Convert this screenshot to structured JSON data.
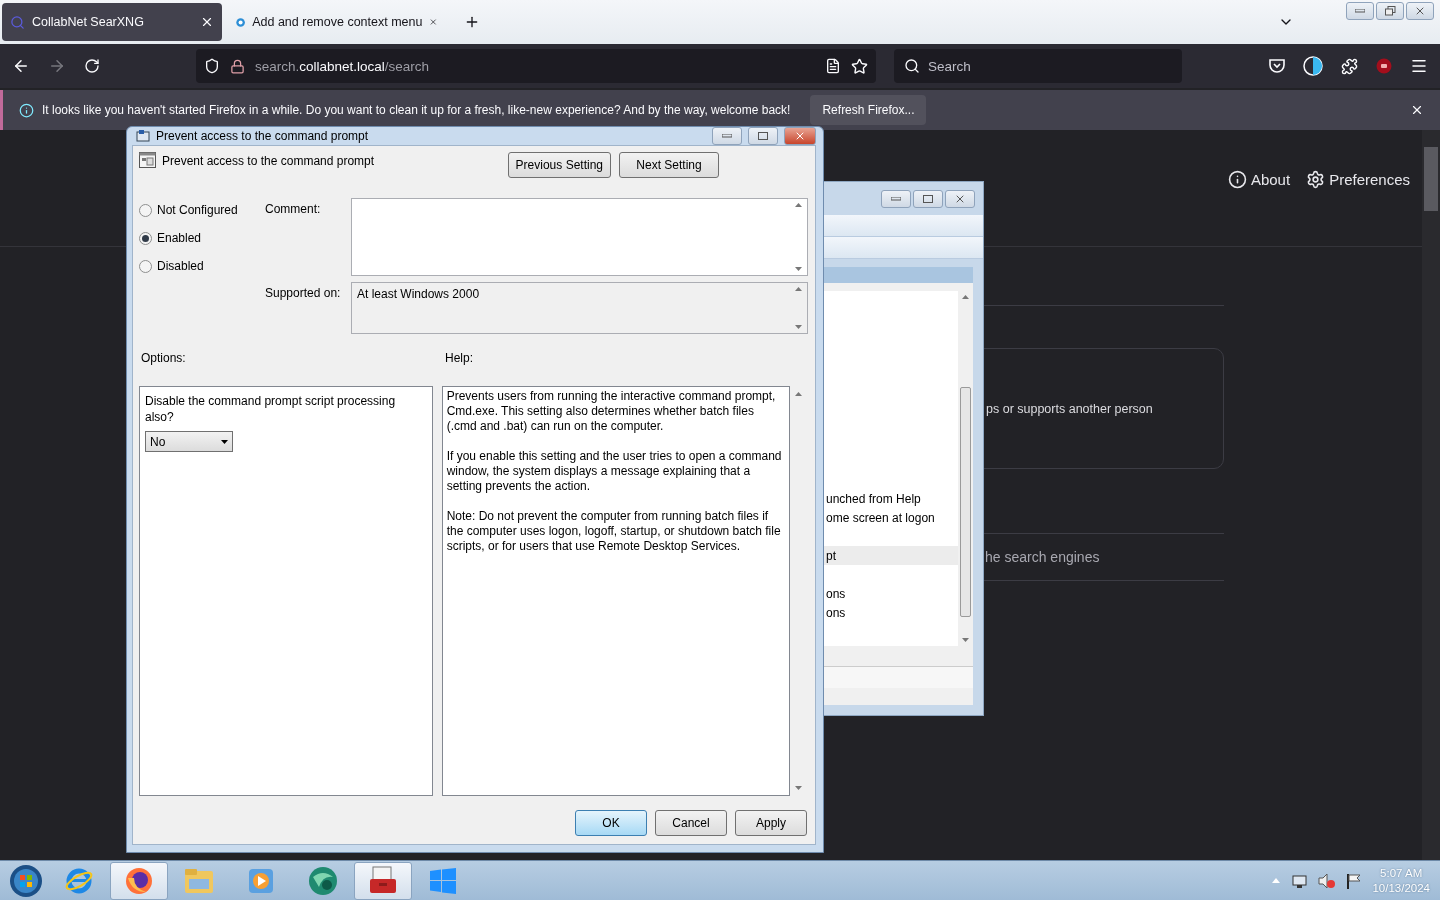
{
  "browser": {
    "tabs": [
      {
        "title": "CollabNet SearXNG",
        "kind": "search",
        "selected": true
      },
      {
        "title": "Add and remove context menu",
        "kind": "site",
        "selected": false
      }
    ],
    "address": {
      "prefix": "search.",
      "domain": "collabnet.local",
      "path": "/search"
    },
    "search": {
      "placeholder": "Search"
    },
    "notification": {
      "message": "It looks like you haven't started Firefox in a while. Do you want to clean it up for a fresh, like-new experience? And by the way, welcome back!",
      "button": "Refresh Firefox..."
    }
  },
  "page": {
    "nav": [
      {
        "label": "About",
        "kind": "info"
      },
      {
        "label": "Preferences",
        "kind": "gear"
      }
    ],
    "fragments": [
      {
        "kind": "card",
        "text": "ps or supports another person"
      },
      {
        "kind": "row"
      },
      {
        "kind": "row",
        "text": "he search engines"
      }
    ]
  },
  "background_window": {
    "items": [
      {
        "text": "unched from Help",
        "selected": false
      },
      {
        "text": "ome screen at logon",
        "selected": false
      },
      {
        "text": "pt",
        "selected": true
      },
      {
        "text": "ons",
        "selected": false
      },
      {
        "text": "ons",
        "selected": false
      }
    ]
  },
  "dialog": {
    "title": "Prevent access to the command prompt",
    "setting": "Prevent access to the command prompt",
    "nav_buttons": [
      "Previous Setting",
      "Next Setting"
    ],
    "states": [
      {
        "label": "Not Configured",
        "selected": false
      },
      {
        "label": "Enabled",
        "selected": true
      },
      {
        "label": "Disabled",
        "selected": false
      }
    ],
    "comment_label": "Comment:",
    "supported_label": "Supported on:",
    "supported_value": "At least Windows 2000",
    "options_label": "Options:",
    "help_label": "Help:",
    "option_text": "Disable the command prompt script processing also?",
    "option_value": "No",
    "help": [
      "Prevents users from running the interactive command prompt, Cmd.exe. This setting also determines whether batch files (.cmd and .bat) can run on the computer.",
      "If you enable this setting and the user tries to open a command window, the system displays a message explaining that a setting prevents the action.",
      "Note: Do not prevent the computer from running batch files if the computer uses logon, logoff, startup, or shutdown batch file scripts, or for users that use Remote Desktop Services."
    ],
    "buttons": [
      {
        "label": "OK",
        "kind": "default"
      },
      {
        "label": "Cancel",
        "kind": "normal"
      },
      {
        "label": "Apply",
        "kind": "normal"
      }
    ]
  },
  "taskbar": {
    "apps": [
      {
        "kind": "start",
        "selected": false
      },
      {
        "kind": "ie",
        "selected": false
      },
      {
        "kind": "firefox",
        "selected": true
      },
      {
        "kind": "explorer",
        "selected": false
      },
      {
        "kind": "media",
        "selected": false
      },
      {
        "kind": "globe",
        "selected": false
      },
      {
        "kind": "toolbox",
        "selected": true
      },
      {
        "kind": "windows",
        "selected": false
      }
    ],
    "time": "5:07 AM",
    "date": "10/13/2024"
  }
}
